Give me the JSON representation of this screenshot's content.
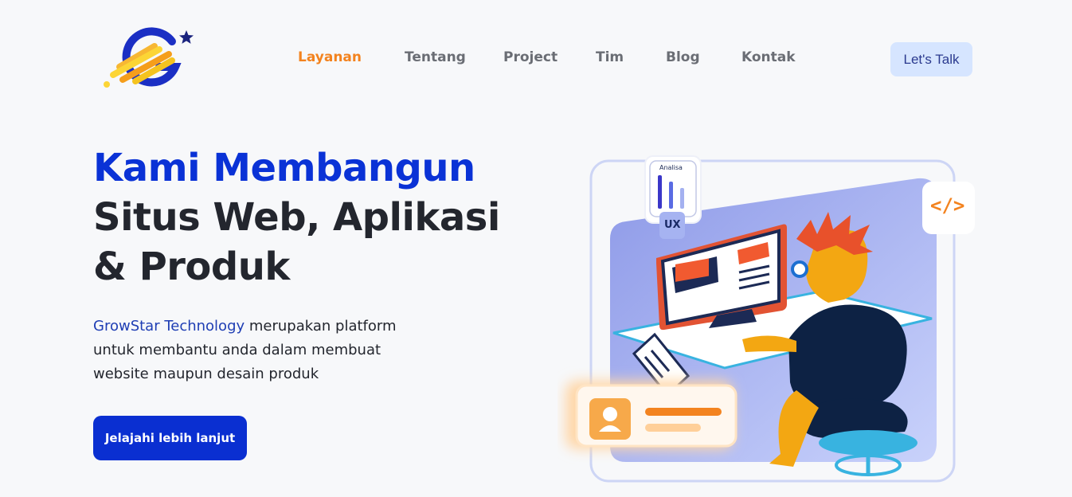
{
  "brand": {
    "logo_name": "GrowStar logo"
  },
  "nav": {
    "items": [
      {
        "label": "Layanan",
        "active": true
      },
      {
        "label": "Tentang",
        "active": false
      },
      {
        "label": "Project",
        "active": false
      },
      {
        "label": "Tim",
        "active": false
      },
      {
        "label": "Blog",
        "active": false
      },
      {
        "label": "Kontak",
        "active": false
      }
    ],
    "cta_label": "Let's Talk"
  },
  "hero": {
    "title_line1": "Kami Membangun",
    "title_line2": "Situs Web, Aplikasi",
    "title_line3": "& Produk",
    "desc_brand": "GrowStar Technology",
    "desc_rest": " merupakan platform untuk membantu anda dalam membuat website maupun desain produk",
    "button_label": "Jelajahi lebih lanjut"
  },
  "illustration": {
    "card_analisa": "Analisa",
    "badge_ux": "UX",
    "code_badge": "</>"
  },
  "colors": {
    "accent_orange": "#f3831f",
    "brand_blue": "#0a32d6",
    "button_blue": "#0a2fd1",
    "cta_bg": "#d6e5ff"
  }
}
